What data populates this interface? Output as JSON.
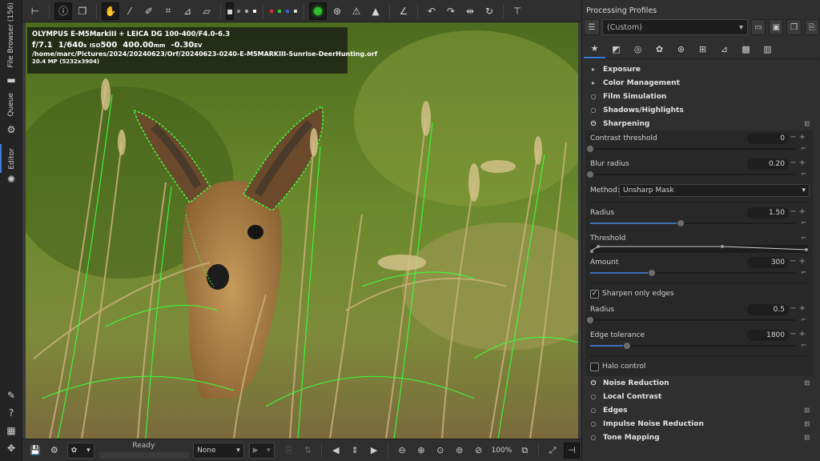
{
  "left_tabs": {
    "file_browser": "File Browser (156)",
    "queue": "Queue",
    "editor": "Editor"
  },
  "toolbar_icons": [
    "history-toggle-icon",
    "info-icon",
    "before-after-icon",
    "hand-icon",
    "color-picker-icon",
    "white-balance-picker-icon",
    "crop-icon",
    "straighten-icon",
    "perspective-icon",
    "preview-mode-icon",
    "channel-r",
    "channel-g",
    "channel-b",
    "focus-mask-icon",
    "shadow-clip-icon",
    "highlight-clip-icon",
    "warning-icon",
    "graph-icon",
    "rotate-left-icon",
    "rotate-right-icon",
    "flip-h-icon",
    "flip-v-icon",
    "pin-icon"
  ],
  "exif": {
    "camera": "OLYMPUS E-M5MarkIII + LEICA DG 100-400/F4.0-6.3",
    "fnum": "f/7.1",
    "shutter": "1/640",
    "shutter_unit": "s",
    "iso_label": "ISO",
    "iso": "500",
    "focal": "400.00",
    "focal_unit": "mm",
    "ev": "-0.30",
    "ev_unit": "EV",
    "path": "/home/marc/Pictures/2024/20240623/Orf/20240623-0240-E-M5MARKIII-Sunrise-DeerHunting.orf",
    "size": "20.4 MP (5232x3904)"
  },
  "bottom": {
    "status": "Ready",
    "none_label": "None",
    "zoom": "100%"
  },
  "panel": {
    "title": "Processing Profiles",
    "profile": "(Custom)",
    "sections": {
      "exposure": "Exposure",
      "color_management": "Color Management",
      "film_simulation": "Film Simulation",
      "shadows_highlights": "Shadows/Highlights",
      "sharpening": "Sharpening",
      "noise_reduction": "Noise Reduction",
      "local_contrast": "Local Contrast",
      "edges": "Edges",
      "impulse_nr": "Impulse Noise Reduction",
      "tone_mapping": "Tone Mapping"
    },
    "sharpening": {
      "contrast_threshold": {
        "label": "Contrast threshold",
        "value": "0",
        "frac": 0
      },
      "blur_radius": {
        "label": "Blur radius",
        "value": "0.20",
        "frac": 0
      },
      "method_label": "Method:",
      "method_value": "Unsharp Mask",
      "radius": {
        "label": "Radius",
        "value": "1.50",
        "frac": 0.44
      },
      "threshold_label": "Threshold",
      "amount": {
        "label": "Amount",
        "value": "300",
        "frac": 0.3
      },
      "sharpen_edges": "Sharpen only edges",
      "edge_radius": {
        "label": "Radius",
        "value": "0.5",
        "frac": 0
      },
      "edge_tolerance": {
        "label": "Edge tolerance",
        "value": "1800",
        "frac": 0.18
      },
      "halo_control": "Halo control"
    }
  },
  "colors": {
    "accent": "#3c7bd8",
    "focus_mask": "#3cff3c"
  }
}
